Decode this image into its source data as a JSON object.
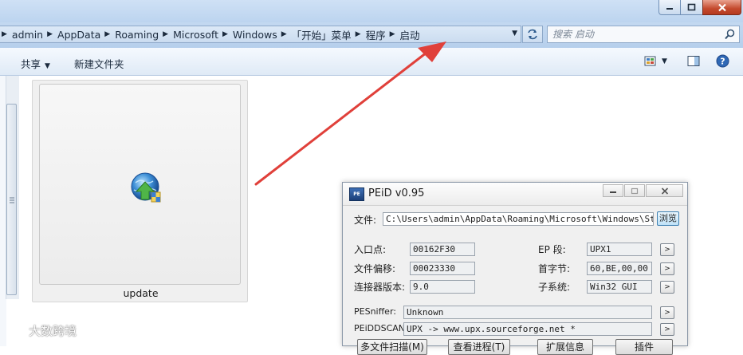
{
  "explorer": {
    "breadcrumbs": [
      "admin",
      "AppData",
      "Roaming",
      "Microsoft",
      "Windows",
      "「开始」菜单",
      "程序",
      "启动"
    ],
    "search_placeholder": "搜索 启动",
    "toolbar": {
      "share_label": "共享",
      "new_folder_label": "新建文件夹"
    },
    "file": {
      "name": "update",
      "icon": "installer-globe-icon"
    }
  },
  "peid": {
    "title": "PEiD v0.95",
    "file_label": "文件:",
    "file_path": "C:\\Users\\admin\\AppData\\Roaming\\Microsoft\\Windows\\Start",
    "browse_label": "浏览",
    "entry_point_label": "入口点:",
    "entry_point_value": "00162F30",
    "file_offset_label": "文件偏移:",
    "file_offset_value": "00023330",
    "linker_version_label": "连接器版本:",
    "linker_version_value": "9.0",
    "ep_section_label": "EP 段:",
    "ep_section_value": "UPX1",
    "first_bytes_label": "首字节:",
    "first_bytes_value": "60,BE,00,00",
    "subsystem_label": "子系统:",
    "subsystem_value": "Win32 GUI",
    "pesniffer_label": "PESniffer:",
    "pesniffer_value": "Unknown",
    "peiddscan_label": "PEiDDSCAN:",
    "peiddscan_value": "UPX -> www.upx.sourceforge.net *",
    "buttons": {
      "multi_scan": "多文件扫描(M)",
      "task_viewer": "查看进程(T)",
      "extra_info": "扩展信息",
      "plugins": "插件"
    }
  },
  "watermark": {
    "text": "大数跨境"
  },
  "colors": {
    "arrow": "#e0403a",
    "close_button": "#c44a2d",
    "explorer_chrome": "#c3d8f0"
  }
}
